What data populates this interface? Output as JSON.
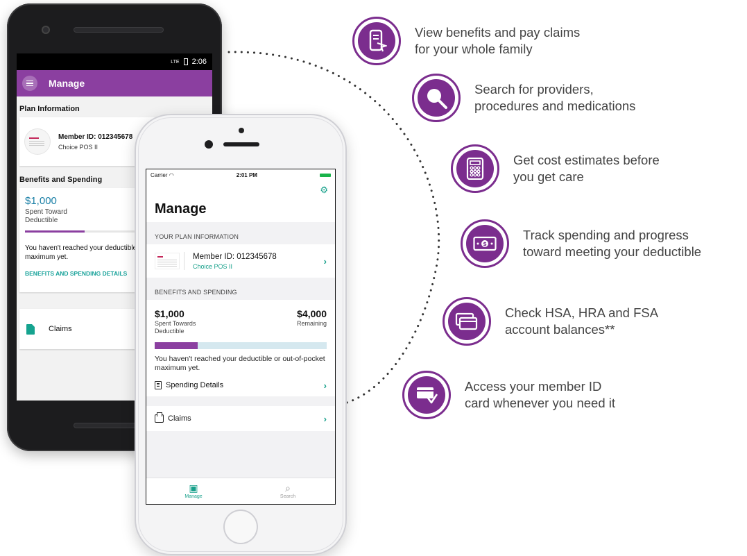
{
  "android": {
    "status_time": "2:06",
    "status_signal": "LTE",
    "title": "Manage",
    "plan_section": "Plan Information",
    "member_id": "Member ID: 012345678",
    "plan_name": "Choice POS II",
    "benefits_section": "Benefits and Spending",
    "amount": "$1,000",
    "spent_line1": "Spent Toward",
    "spent_line2": "Deductible",
    "progress": 0.33,
    "message": "You haven't reached your deductible or out-of-pocket maximum yet.",
    "details_link": "BENEFITS AND SPENDING DETAILS",
    "claims": "Claims"
  },
  "iphone": {
    "carrier": "Carrier",
    "wifi_icon": "wifi-icon",
    "time": "2:01 PM",
    "title": "Manage",
    "plan_section": "YOUR PLAN INFORMATION",
    "member_id": "Member ID: 012345678",
    "plan_name": "Choice POS II",
    "benefits_section": "BENEFITS AND SPENDING",
    "spent_amount": "$1,000",
    "spent_label_1": "Spent Towards",
    "spent_label_2": "Deductible",
    "remaining_amount": "$4,000",
    "remaining_label": "Remaining",
    "progress": 0.25,
    "message": "You haven't reached your deductible or out-of-pocket maximum yet.",
    "spending_details": "Spending Details",
    "claims": "Claims",
    "tabs": [
      {
        "label": "Manage",
        "icon": "manage-card-icon",
        "active": true
      },
      {
        "label": "Search",
        "icon": "search-icon",
        "active": false
      }
    ]
  },
  "features": [
    {
      "icon": "mobile-phone-icon",
      "line1": "View benefits and pay claims",
      "line2": "for your whole family"
    },
    {
      "icon": "magnifier-icon",
      "line1": "Search for providers,",
      "line2": "procedures and medications"
    },
    {
      "icon": "calculator-icon",
      "line1": "Get cost estimates before",
      "line2": "you get care"
    },
    {
      "icon": "money-bill-icon",
      "line1": "Track spending and progress",
      "line2": "toward meeting your deductible"
    },
    {
      "icon": "cards-icon",
      "line1": "Check HSA, HRA and FSA",
      "line2": "account balances**"
    },
    {
      "icon": "id-card-hand-icon",
      "line1": "Access your member ID",
      "line2": "card whenever you need it"
    }
  ],
  "colors": {
    "brand_purple": "#7b2d8e",
    "android_appbar": "#8b3fa0",
    "teal": "#16a08a",
    "link_blue": "#1a7fa6"
  }
}
